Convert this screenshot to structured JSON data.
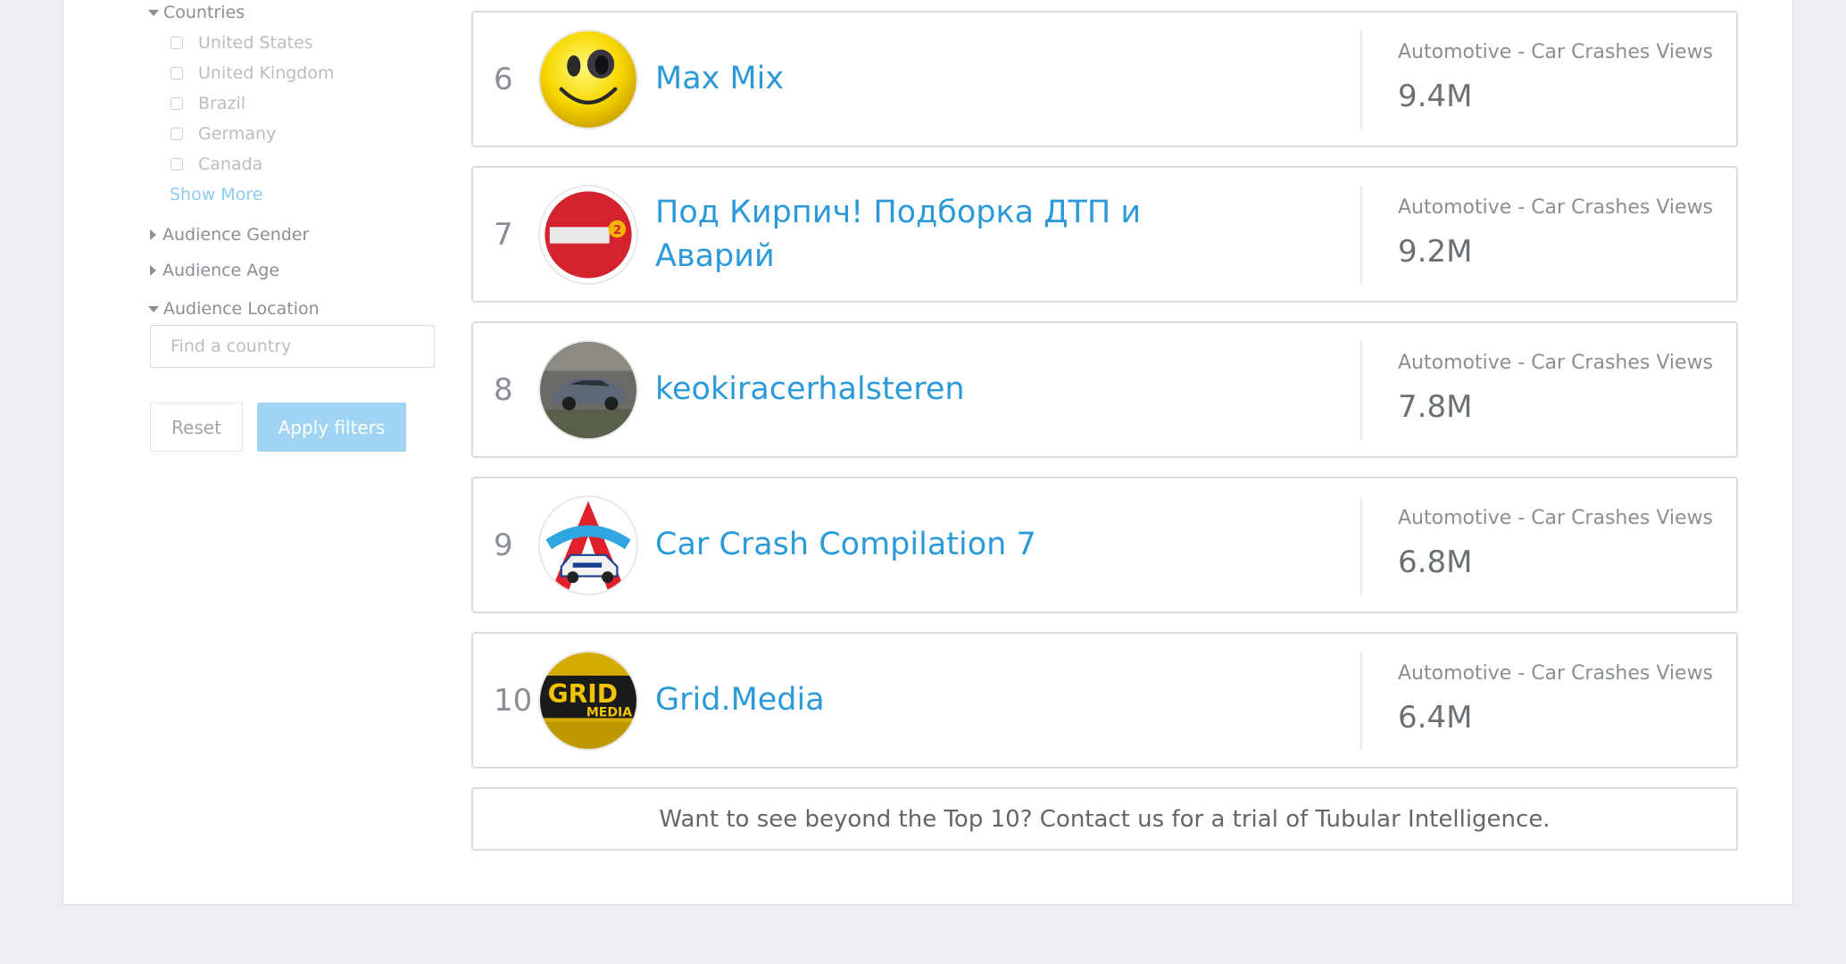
{
  "sidebar": {
    "countries_label": "Countries",
    "countries": [
      "United States",
      "United Kingdom",
      "Brazil",
      "Germany",
      "Canada"
    ],
    "show_more": "Show More",
    "audience_gender": "Audience Gender",
    "audience_age": "Audience Age",
    "audience_location": "Audience Location",
    "country_placeholder": "Find a country",
    "reset": "Reset",
    "apply": "Apply filters"
  },
  "rankings": [
    {
      "rank": "6",
      "name": "Max Mix",
      "category": "Automotive - Car Crashes Views",
      "views": "9.4M",
      "avatar_icon": "smiley-face-icon"
    },
    {
      "rank": "7",
      "name": "Под Кирпич! Подборка ДТП и Аварий",
      "category": "Automotive - Car Crashes Views",
      "views": "9.2M",
      "avatar_icon": "no-entry-sign-icon"
    },
    {
      "rank": "8",
      "name": "keokiracerhalsteren",
      "category": "Automotive - Car Crashes Views",
      "views": "7.8M",
      "avatar_icon": "car-photo-icon"
    },
    {
      "rank": "9",
      "name": "Car Crash Compilation 7",
      "category": "Automotive - Car Crashes Views",
      "views": "6.8M",
      "avatar_icon": "police-car-logo-icon"
    },
    {
      "rank": "10",
      "name": "Grid.Media",
      "category": "Automotive - Car Crashes Views",
      "views": "6.4M",
      "avatar_icon": "grid-media-logo-icon"
    }
  ],
  "cta": "Want to see beyond the Top 10? Contact us for a trial of Tubular Intelligence.",
  "colors": {
    "link": "#2c9ad8",
    "apply_button": "#9fd5f2",
    "page_bg": "#eceef2"
  }
}
